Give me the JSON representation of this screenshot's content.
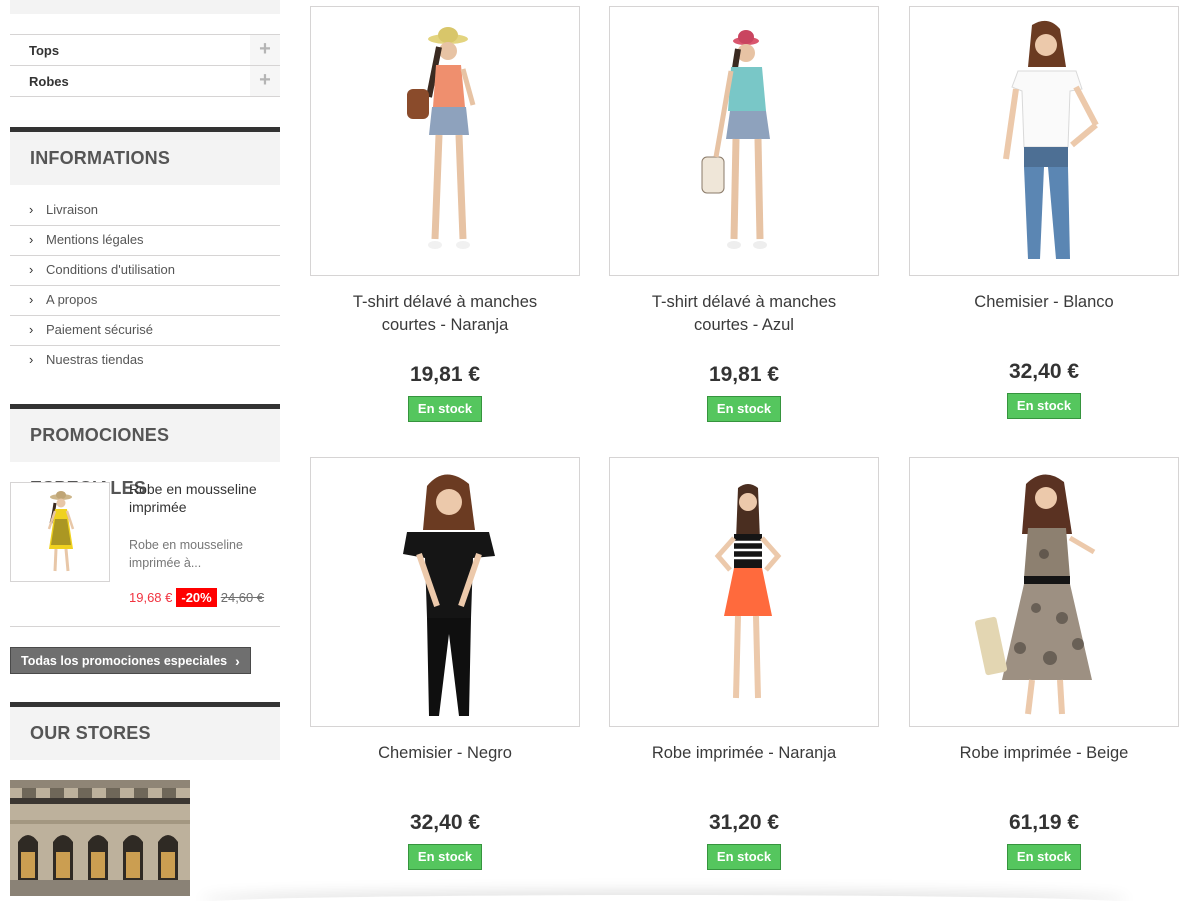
{
  "categories": [
    {
      "label": "Tops",
      "toggle": "+"
    },
    {
      "label": "Robes",
      "toggle": "+"
    }
  ],
  "informations": {
    "title": "INFORMATIONS",
    "items": [
      "Livraison",
      "Mentions légales",
      "Conditions d'utilisation",
      "A propos",
      "Paiement sécurisé",
      "Nuestras tiendas"
    ]
  },
  "promotions": {
    "title": "PROMOCIONES ESPECIALES",
    "product_name": "Robe en mousseline imprimée",
    "product_desc": "Robe en mousseline imprimée à...",
    "price": "19,68 €",
    "reduction": "-20%",
    "old_price": "24,60 €",
    "all_button": "Todas los promociones especiales"
  },
  "stores": {
    "title": "OUR STORES"
  },
  "products": [
    {
      "name": "T-shirt délavé à manches courtes - Naranja",
      "price": "19,81 €",
      "stock": "En stock"
    },
    {
      "name": "T-shirt délavé à manches courtes - Azul",
      "price": "19,81 €",
      "stock": "En stock"
    },
    {
      "name": "Chemisier - Blanco",
      "price": "32,40 €",
      "stock": "En stock"
    },
    {
      "name": "Chemisier - Negro",
      "price": "32,40 €",
      "stock": "En stock"
    },
    {
      "name": "Robe imprimée - Naranja",
      "price": "31,20 €",
      "stock": "En stock"
    },
    {
      "name": "Robe imprimée - Beige",
      "price": "61,19 €",
      "stock": "En stock"
    }
  ],
  "colors": {
    "accent_dark": "#333333",
    "stock_green": "#55c65e",
    "promo_red": "#f13340"
  }
}
